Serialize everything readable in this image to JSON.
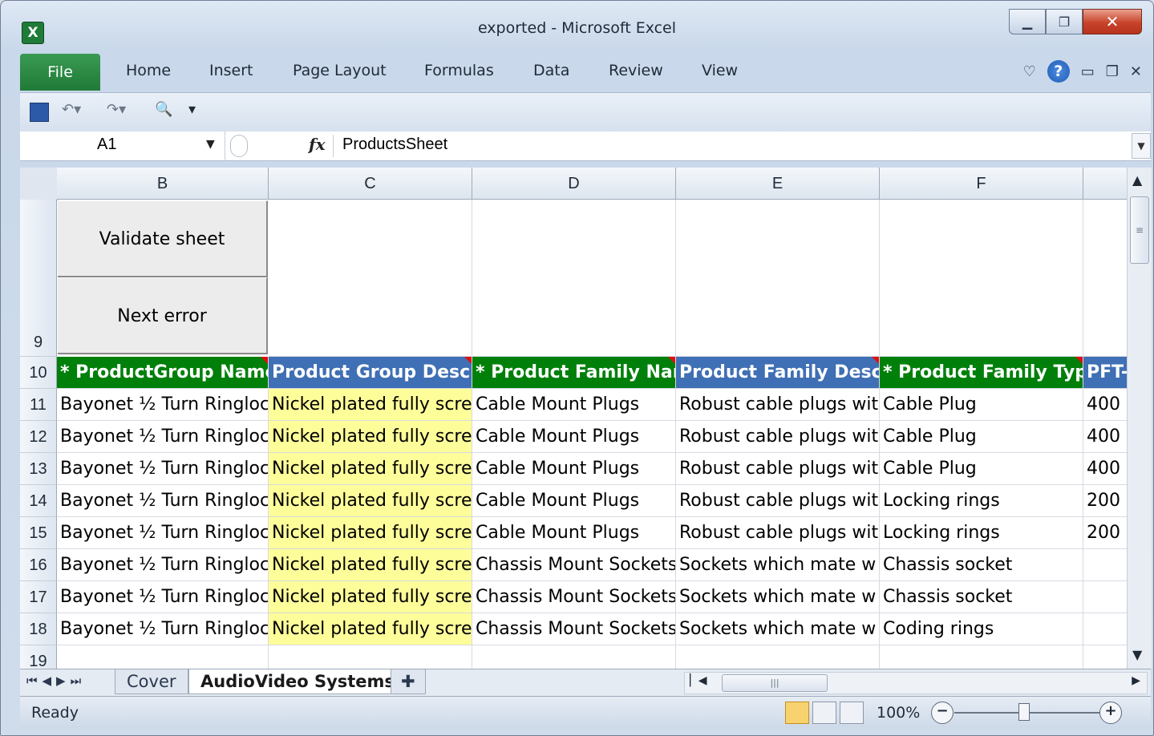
{
  "window": {
    "title": "exported - Microsoft Excel",
    "app_icon": "X"
  },
  "ribbon": {
    "file": "File",
    "tabs": [
      "Home",
      "Insert",
      "Page Layout",
      "Formulas",
      "Data",
      "Review",
      "View"
    ]
  },
  "formula_bar": {
    "name_box": "A1",
    "fx_label": "fx",
    "content": "ProductsSheet"
  },
  "columns": [
    "B",
    "C",
    "D",
    "E",
    "F"
  ],
  "buttons": {
    "validate": "Validate sheet",
    "next_error": "Next error"
  },
  "header_row": {
    "row_num": "10",
    "cells": [
      "* ProductGroup Name",
      "Product Group Descrip",
      "* Product Family Name",
      "Product Family Descrip",
      "* Product Family Type",
      "PFT-"
    ]
  },
  "rows": [
    {
      "num": "11",
      "b": "Bayonet ½ Turn Ringloc",
      "c": "Nickel plated fully scre",
      "d": "Cable Mount Plugs",
      "e": "Robust cable plugs wit",
      "f": "Cable Plug",
      "g": "400"
    },
    {
      "num": "12",
      "b": "Bayonet ½ Turn Ringloc",
      "c": "Nickel plated fully scre",
      "d": "Cable Mount Plugs",
      "e": "Robust cable plugs wit",
      "f": "Cable Plug",
      "g": "400"
    },
    {
      "num": "13",
      "b": "Bayonet ½ Turn Ringloc",
      "c": "Nickel plated fully scre",
      "d": "Cable Mount Plugs",
      "e": "Robust cable plugs wit",
      "f": "Cable Plug",
      "g": "400"
    },
    {
      "num": "14",
      "b": "Bayonet ½ Turn Ringloc",
      "c": "Nickel plated fully scre",
      "d": "Cable Mount Plugs",
      "e": "Robust cable plugs wit",
      "f": "Locking rings",
      "g": "200"
    },
    {
      "num": "15",
      "b": "Bayonet ½ Turn Ringloc",
      "c": "Nickel plated fully scre",
      "d": "Cable Mount Plugs",
      "e": "Robust cable plugs wit",
      "f": "Locking rings",
      "g": "200"
    },
    {
      "num": "16",
      "b": "Bayonet ½ Turn Ringloc",
      "c": "Nickel plated fully scre",
      "d": "Chassis Mount Sockets",
      "e": "Sockets which mate w",
      "f": "Chassis socket",
      "g": ""
    },
    {
      "num": "17",
      "b": "Bayonet ½ Turn Ringloc",
      "c": "Nickel plated fully scre",
      "d": "Chassis Mount Sockets",
      "e": "Sockets which mate w",
      "f": "Chassis socket",
      "g": ""
    },
    {
      "num": "18",
      "b": "Bayonet ½ Turn Ringloc",
      "c": "Nickel plated fully scre",
      "d": "Chassis Mount Sockets",
      "e": "Sockets which mate w",
      "f": "Coding rings",
      "g": ""
    }
  ],
  "row_labels": {
    "r9": "9",
    "r19": "19"
  },
  "sheet_tabs": [
    "Cover",
    "AudioVideo Systems"
  ],
  "active_sheet": "AudioVideo Systems",
  "status": {
    "text": "Ready",
    "zoom": "100%"
  },
  "colors": {
    "header_green": "#00800a",
    "header_blue": "#3f6fb4",
    "highlight_yellow": "#fdfd9a"
  }
}
